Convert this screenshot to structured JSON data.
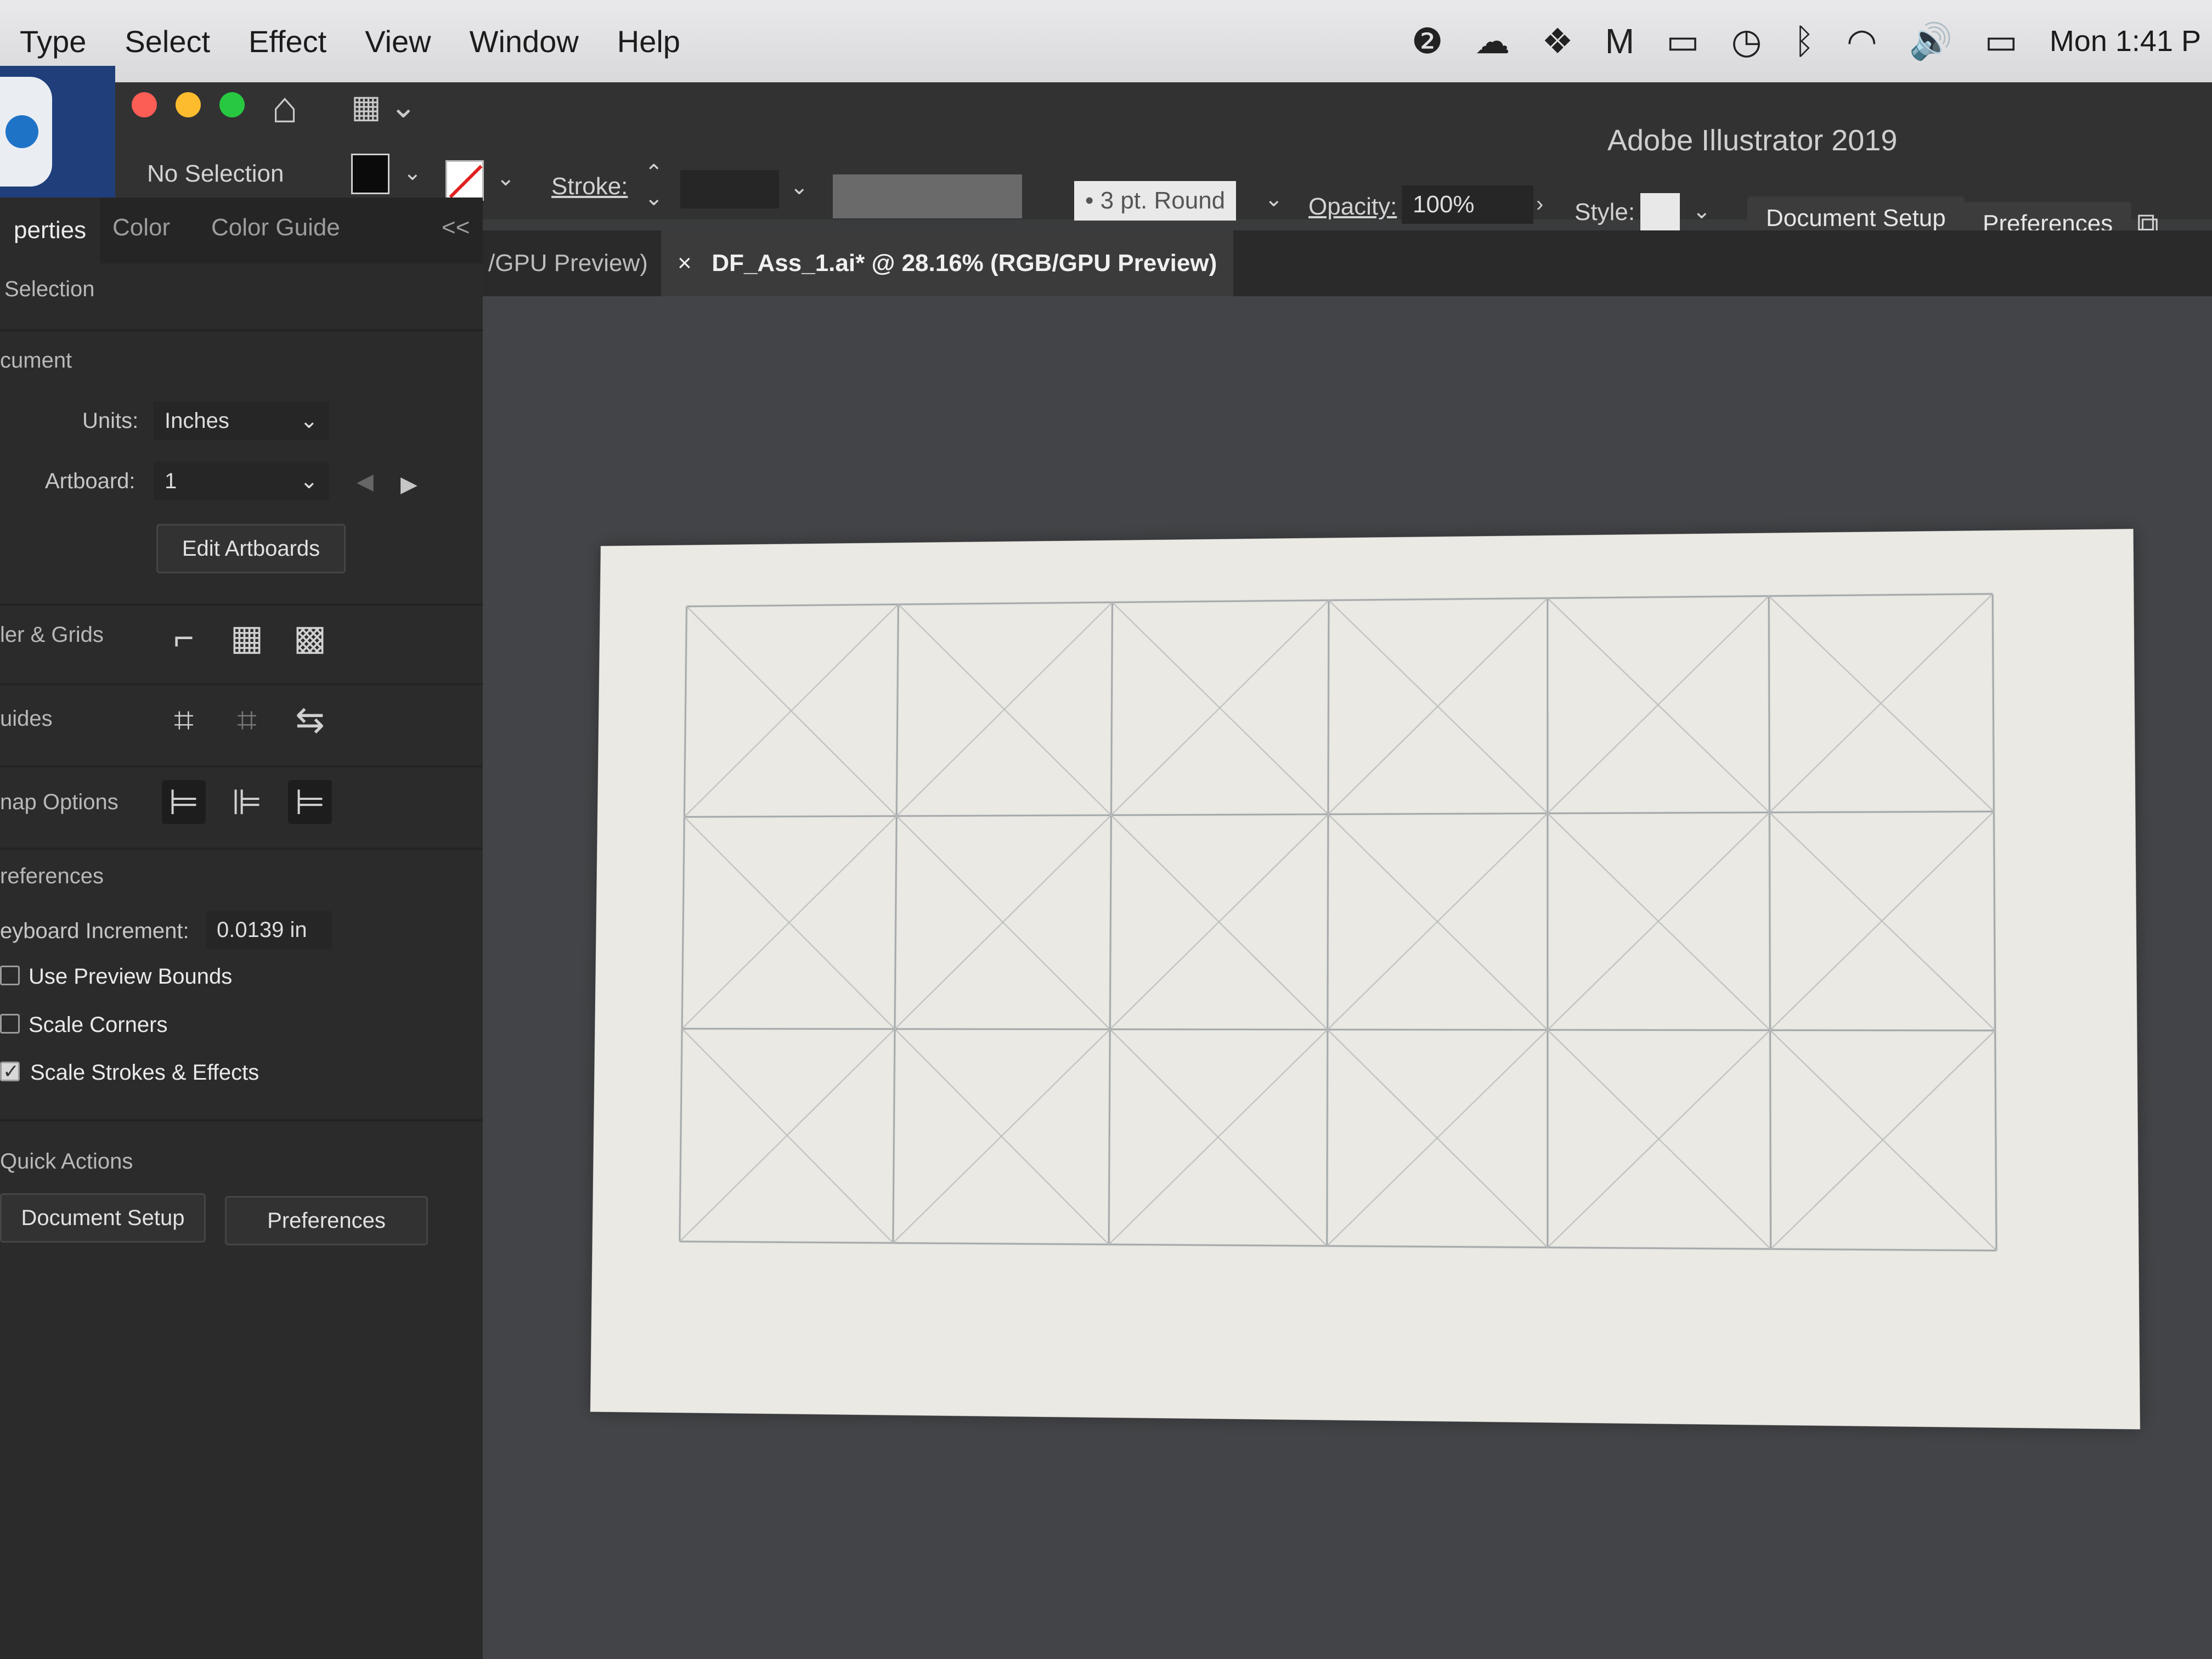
{
  "menubar": {
    "items": [
      "Type",
      "Select",
      "Effect",
      "View",
      "Window",
      "Help"
    ],
    "clock": "Mon 1:41 P"
  },
  "window": {
    "title": "Adobe Illustrator 2019"
  },
  "control_bar": {
    "selection_label": "No Selection",
    "stroke_label": "Stroke:",
    "brush_label": "3 pt. Round",
    "opacity_label": "Opacity:",
    "opacity_value": "100%",
    "style_label": "Style:",
    "document_setup": "Document Setup",
    "preferences": "Preferences"
  },
  "tabs": [
    {
      "label": "/GPU Preview)"
    },
    {
      "close": "×",
      "label": "DF_Ass_1.ai* @ 28.16% (RGB/GPU Preview)"
    }
  ],
  "panel": {
    "tabs": [
      "perties",
      "Color",
      "Color Guide"
    ],
    "collapse": "<<",
    "selection_header": "Selection",
    "document_header": "cument",
    "units_label": "Units:",
    "units_value": "Inches",
    "artboard_label": "Artboard:",
    "artboard_value": "1",
    "edit_artboards": "Edit Artboards",
    "rulers_grids": "ler & Grids",
    "guides": "uides",
    "snap_options": "nap Options",
    "preferences_header": "references",
    "keyboard_increment_label": "eyboard Increment:",
    "keyboard_increment_value": "0.0139 in",
    "use_preview_bounds": "Use Preview Bounds",
    "scale_corners": "Scale Corners",
    "scale_strokes": "Scale Strokes & Effects",
    "quick_actions": "Quick Actions",
    "qa_document_setup": "Document Setup",
    "qa_preferences": "Preferences"
  },
  "checkboxes": {
    "use_preview_bounds": false,
    "scale_corners": false,
    "scale_strokes": true
  },
  "colors": {
    "fill": "#0b0b0b",
    "artboard": "#ebe9e4",
    "canvas": "#434447",
    "panel": "#2b2b2c"
  },
  "grid": {
    "columns": 6,
    "rows": 3
  }
}
